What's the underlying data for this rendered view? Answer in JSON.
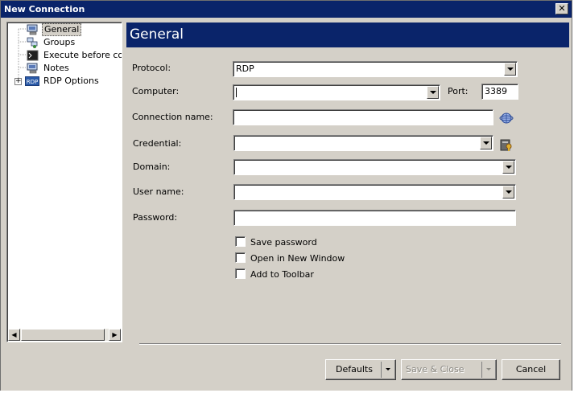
{
  "window": {
    "title": "New Connection",
    "close_glyph": "✕"
  },
  "tree": {
    "items": [
      {
        "label": "General",
        "icon": "computer-icon",
        "selected": true
      },
      {
        "label": "Groups",
        "icon": "groups-icon"
      },
      {
        "label": "Execute before conr",
        "icon": "console-icon"
      },
      {
        "label": "Notes",
        "icon": "notes-icon"
      },
      {
        "label": "RDP Options",
        "icon": "rdp-icon",
        "expand_glyph": "+"
      }
    ],
    "rdp_badge": "RDP",
    "scroll_left": "◀",
    "scroll_right": "▶"
  },
  "main": {
    "header": "General",
    "protocol": {
      "label": "Protocol:",
      "value": "RDP"
    },
    "computer": {
      "label": "Computer:",
      "value": ""
    },
    "port": {
      "label": "Port:",
      "value": "3389"
    },
    "connection_name": {
      "label": "Connection name:",
      "value": ""
    },
    "credential": {
      "label": "Credential:",
      "value": ""
    },
    "domain": {
      "label": "Domain:",
      "value": ""
    },
    "user_name": {
      "label": "User name:",
      "value": ""
    },
    "password": {
      "label": "Password:",
      "value": ""
    },
    "checkboxes": [
      {
        "label": "Save password",
        "checked": false
      },
      {
        "label": "Open in New Window",
        "checked": false
      },
      {
        "label": "Add to Toolbar",
        "checked": false
      }
    ]
  },
  "buttons": {
    "defaults": "Defaults",
    "save_close": "Save & Close",
    "cancel": "Cancel"
  },
  "colors": {
    "title_bar": "#0a246a",
    "header_bar": "#0a246a",
    "face": "#d4d0c8"
  }
}
